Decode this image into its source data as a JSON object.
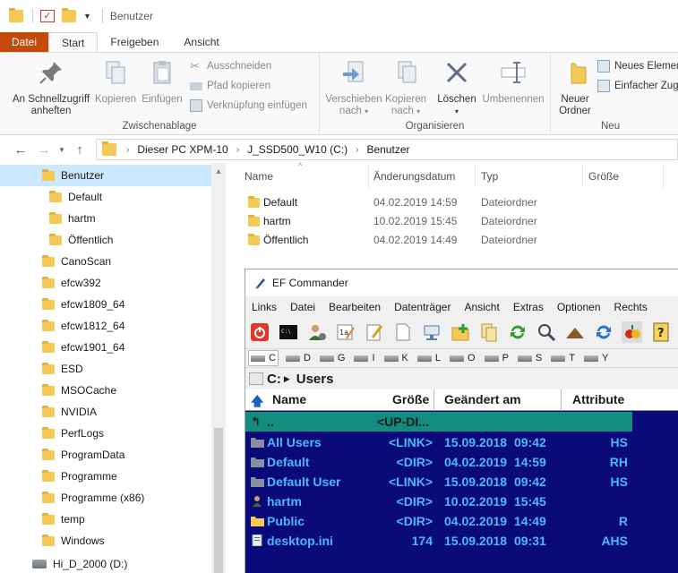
{
  "window": {
    "title": "Benutzer"
  },
  "ribbon_tabs": [
    "Datei",
    "Start",
    "Freigeben",
    "Ansicht"
  ],
  "ribbon": {
    "clipboard": {
      "label": "Zwischenablage",
      "pin_label_1": "An Schnellzugriff",
      "pin_label_2": "anheften",
      "copy_label": "Kopieren",
      "paste_label": "Einfügen",
      "cut_label": "Ausschneiden",
      "copy_path_label": "Pfad kopieren",
      "paste_shortcut_label": "Verknüpfung einfügen"
    },
    "organize": {
      "label": "Organisieren",
      "move_label_1": "Verschieben",
      "move_label_2": "nach",
      "copyto_label_1": "Kopieren",
      "copyto_label_2": "nach",
      "delete_label": "Löschen",
      "rename_label": "Umbenennen"
    },
    "new": {
      "label": "Neu",
      "new_folder_1": "Neuer",
      "new_folder_2": "Ordner",
      "new_item_label": "Neues Elemen",
      "easy_access_label": "Einfacher Zug"
    }
  },
  "address": {
    "crumbs": [
      "Dieser PC XPM-10",
      "J_SSD500_W10 (C:)",
      "Benutzer"
    ]
  },
  "nav_items": [
    {
      "label": "Benutzer",
      "indent": 1,
      "selected": true
    },
    {
      "label": "Default",
      "indent": 2
    },
    {
      "label": "hartm",
      "indent": 2
    },
    {
      "label": "Öffentlich",
      "indent": 2
    },
    {
      "label": "CanoScan",
      "indent": 1
    },
    {
      "label": "efcw392",
      "indent": 1
    },
    {
      "label": "efcw1809_64",
      "indent": 1
    },
    {
      "label": "efcw1812_64",
      "indent": 1
    },
    {
      "label": "efcw1901_64",
      "indent": 1
    },
    {
      "label": "ESD",
      "indent": 1
    },
    {
      "label": "MSOCache",
      "indent": 1
    },
    {
      "label": "NVIDIA",
      "indent": 1
    },
    {
      "label": "PerfLogs",
      "indent": 1
    },
    {
      "label": "ProgramData",
      "indent": 1
    },
    {
      "label": "Programme",
      "indent": 1
    },
    {
      "label": "Programme (x86)",
      "indent": 1
    },
    {
      "label": "temp",
      "indent": 1
    },
    {
      "label": "Windows",
      "indent": 1
    }
  ],
  "nav_drive": "Hi_D_2000 (D:)",
  "list_headers": {
    "name": "Name",
    "date": "Änderungsdatum",
    "type": "Typ",
    "size": "Größe"
  },
  "files": [
    {
      "name": "Default",
      "date": "04.02.2019 14:59",
      "type": "Dateiordner"
    },
    {
      "name": "hartm",
      "date": "10.02.2019 15:45",
      "type": "Dateiordner"
    },
    {
      "name": "Öffentlich",
      "date": "04.02.2019 14:49",
      "type": "Dateiordner"
    }
  ],
  "efc": {
    "title": "EF Commander",
    "menu": [
      "Links",
      "Datei",
      "Bearbeiten",
      "Datenträger",
      "Ansicht",
      "Extras",
      "Optionen",
      "Rechts"
    ],
    "drives": [
      "C",
      "D",
      "G",
      "I",
      "K",
      "L",
      "O",
      "P",
      "S",
      "T",
      "Y"
    ],
    "path_drive": "C:",
    "path_dir": "Users",
    "headers": {
      "name": "Name",
      "size": "Größe",
      "date": "Geändert am",
      "attr": "Attribute"
    },
    "up_row": {
      "name": "..",
      "size": "<UP-DI..."
    },
    "rows": [
      {
        "name": "All Users",
        "size": "<LINK>",
        "date": "15.09.2018",
        "time": "09:42",
        "attr": "HS"
      },
      {
        "name": "Default",
        "size": "<DIR>",
        "date": "04.02.2019",
        "time": "14:59",
        "attr": "RH"
      },
      {
        "name": "Default User",
        "size": "<LINK>",
        "date": "15.09.2018",
        "time": "09:42",
        "attr": "HS"
      },
      {
        "name": "hartm",
        "size": "<DIR>",
        "date": "10.02.2019",
        "time": "15:45",
        "attr": ""
      },
      {
        "name": "Public",
        "size": "<DIR>",
        "date": "04.02.2019",
        "time": "14:49",
        "attr": "R"
      },
      {
        "name": "desktop.ini",
        "size": "174",
        "date": "15.09.2018",
        "time": "09:31",
        "attr": "AHS"
      }
    ]
  }
}
